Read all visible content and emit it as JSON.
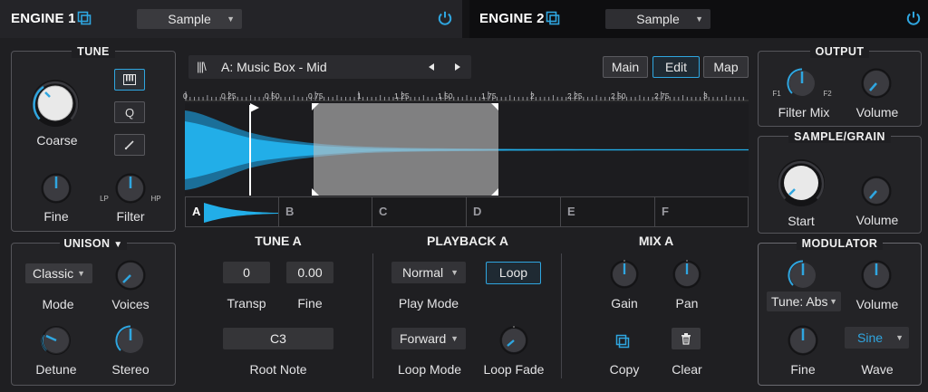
{
  "engine1": {
    "name": "ENGINE 1",
    "type": "Sample",
    "icons": {
      "copy": "copy-icon",
      "power": "power-icon"
    }
  },
  "engine2": {
    "name": "ENGINE 2",
    "type": "Sample",
    "icons": {
      "copy": "copy-icon",
      "power": "power-icon"
    }
  },
  "colors": {
    "accent": "#2fa6e0",
    "waveform": "#1eaee8",
    "panel_bg": "#232326",
    "tab_bg_dark": "#0e0e10"
  },
  "tune": {
    "title": "TUNE",
    "coarse_label": "Coarse",
    "fine_label": "Fine",
    "filter_label": "Filter",
    "filter_lp": "LP",
    "filter_hp": "HP",
    "side_buttons": [
      {
        "name": "keyboard-button",
        "icon": "keyboard-icon"
      },
      {
        "name": "q-button",
        "label": "Q"
      },
      {
        "name": "pencil-button",
        "icon": "pencil-icon"
      }
    ]
  },
  "unison": {
    "title": "UNISON",
    "mode_value": "Classic",
    "mode_label": "Mode",
    "voices_label": "Voices",
    "detune_label": "Detune",
    "stereo_label": "Stereo"
  },
  "sample_editor": {
    "sample_name": "A: Music Box - Mid",
    "browser_icon": "sample-browser-icon",
    "prev_icon": "prev-arrow-icon",
    "next_icon": "next-arrow-icon",
    "view_tabs": [
      "Main",
      "Edit",
      "Map"
    ],
    "active_view": "Edit",
    "ruler_ticks": [
      "0",
      "0.25",
      "0.50",
      "0.75",
      "1",
      "1.25",
      "1.50",
      "1.75",
      "2",
      "2.25",
      "2.50",
      "2.75",
      "3"
    ],
    "slots": [
      "A",
      "B",
      "C",
      "D",
      "E",
      "F"
    ],
    "active_slot": "A"
  },
  "tune_a": {
    "title": "TUNE A",
    "transp_value": "0",
    "transp_label": "Transp",
    "fine_value": "0.00",
    "fine_label": "Fine",
    "root_value": "C3",
    "root_label": "Root Note"
  },
  "playback_a": {
    "title": "PLAYBACK A",
    "play_mode_value": "Normal",
    "play_mode_label": "Play Mode",
    "loop_button": "Loop",
    "loop_mode_value": "Forward",
    "loop_mode_label": "Loop Mode",
    "loop_fade_label": "Loop Fade"
  },
  "mix_a": {
    "title": "MIX A",
    "gain_label": "Gain",
    "pan_label": "Pan",
    "copy_label": "Copy",
    "clear_label": "Clear",
    "copy_icon": "copy-icon",
    "trash_icon": "trash-icon"
  },
  "output": {
    "title": "OUTPUT",
    "f1": "F1",
    "f2": "F2",
    "filter_mix_label": "Filter Mix",
    "volume_label": "Volume"
  },
  "sample_grain": {
    "title": "SAMPLE/GRAIN",
    "start_label": "Start",
    "volume_label": "Volume"
  },
  "modulator": {
    "title": "MODULATOR",
    "target_value": "Tune: Abs",
    "volume_label": "Volume",
    "fine_label": "Fine",
    "wave_value": "Sine",
    "wave_label": "Wave"
  }
}
